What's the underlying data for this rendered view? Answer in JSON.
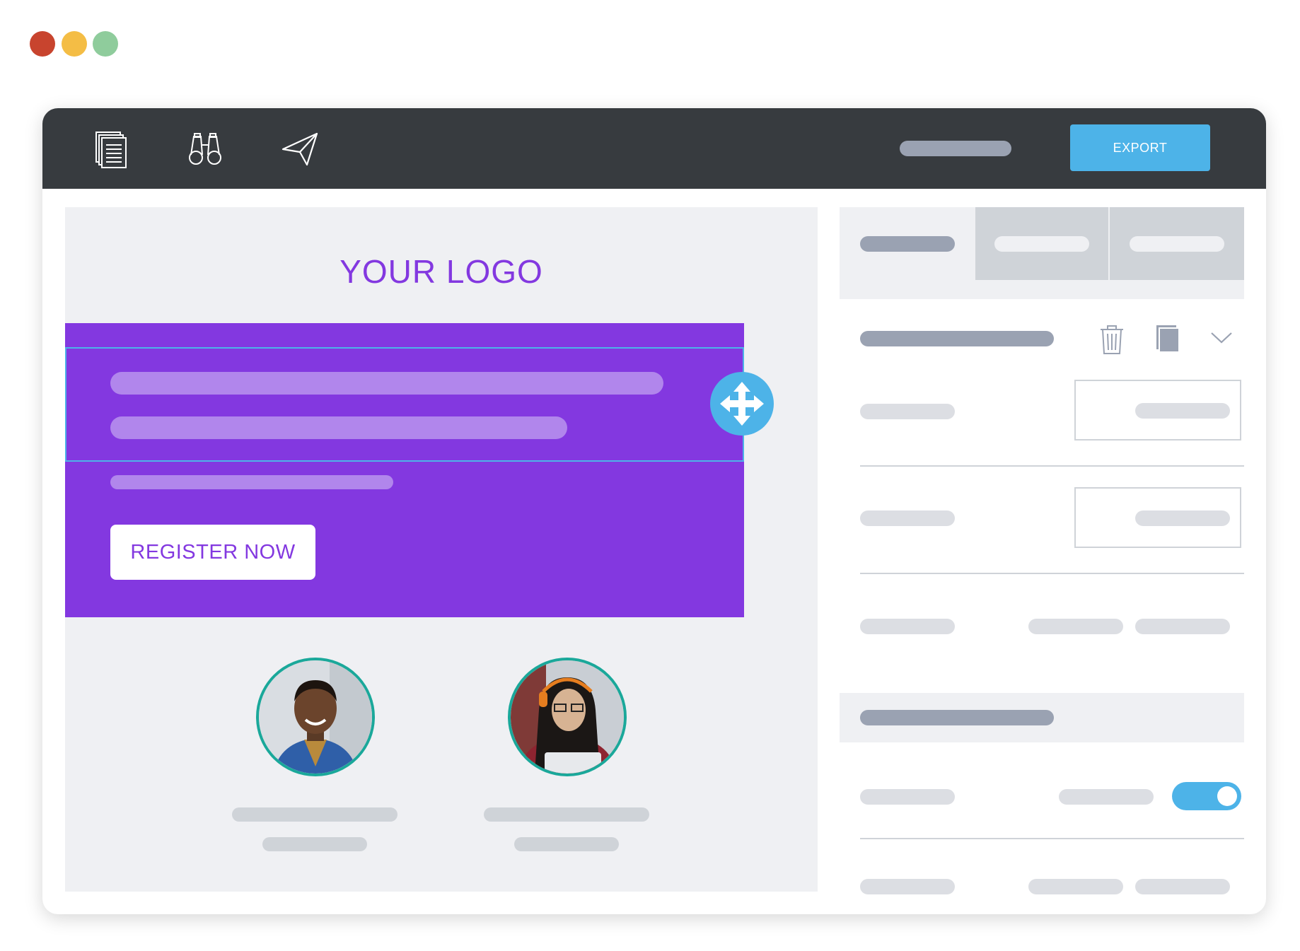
{
  "window_controls": {
    "close_color": "#c8442e",
    "minimize_color": "#f4bd45",
    "maximize_color": "#8fcc9c"
  },
  "toolbar": {
    "icons": [
      "pages-icon",
      "binoculars-icon",
      "send-icon"
    ],
    "export_label": "EXPORT"
  },
  "canvas": {
    "logo_text": "YOUR LOGO",
    "hero": {
      "register_label": "REGISTER NOW",
      "move_icon": "move-arrows-icon"
    },
    "speakers": [
      "speaker-avatar-man",
      "speaker-avatar-woman"
    ]
  },
  "panel": {
    "actions": [
      "trash-icon",
      "copy-icon",
      "chevron-down-icon"
    ],
    "toggle_on": true
  },
  "colors": {
    "accent": "#4db3e8",
    "brand_purple": "#8338e0",
    "toolbar_bg": "#373b3f",
    "avatar_ring": "#1aa89a",
    "placeholder_dark": "#9aa2b2",
    "placeholder_light": "#dcdee3"
  }
}
